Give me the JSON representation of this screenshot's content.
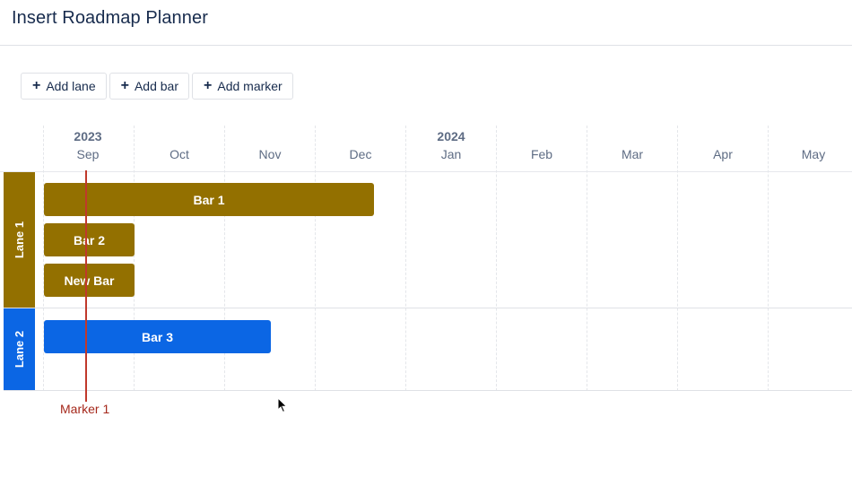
{
  "header": {
    "title": "Insert Roadmap Planner"
  },
  "toolbar": {
    "add_lane": "Add lane",
    "add_bar": "Add bar",
    "add_marker": "Add marker",
    "plus_glyph": "+"
  },
  "timeline": {
    "years": [
      "2023",
      "2024"
    ],
    "months": [
      "Sep",
      "Oct",
      "Nov",
      "Dec",
      "Jan",
      "Feb",
      "Mar",
      "Apr",
      "May"
    ]
  },
  "lanes": [
    {
      "label": "Lane 1",
      "color": "#937000"
    },
    {
      "label": "Lane 2",
      "color": "#0b66e4"
    }
  ],
  "bars": [
    {
      "label": "Bar 1",
      "lane": "Lane 1",
      "start": "Sep",
      "end": "Dec",
      "color": "#937000"
    },
    {
      "label": "Bar 2",
      "lane": "Lane 1",
      "start": "Sep",
      "end": "Sep",
      "color": "#937000"
    },
    {
      "label": "New Bar",
      "lane": "Lane 1",
      "start": "Sep",
      "end": "Sep",
      "color": "#937000"
    },
    {
      "label": "Bar 3",
      "lane": "Lane 2",
      "start": "Sep",
      "end": "Nov",
      "color": "#0b66e4"
    }
  ],
  "markers": [
    {
      "label": "Marker 1",
      "color": "#c0392b"
    }
  ]
}
